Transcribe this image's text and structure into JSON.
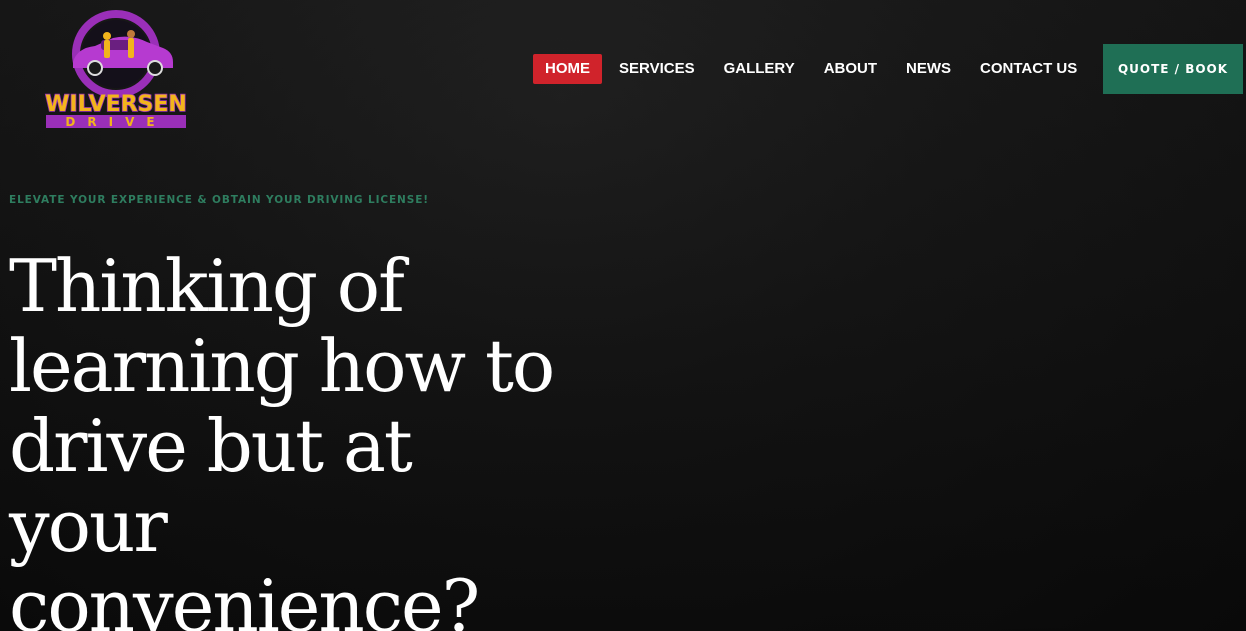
{
  "brand": {
    "logo_line1": "WILVERSEN",
    "logo_line2": "DRIVE",
    "colors": {
      "purple": "#9a2fb8",
      "gold": "#f2b51c"
    }
  },
  "nav": {
    "items": [
      {
        "label": "HOME",
        "active": true
      },
      {
        "label": "SERVICES",
        "active": false
      },
      {
        "label": "GALLERY",
        "active": false
      },
      {
        "label": "ABOUT",
        "active": false
      },
      {
        "label": "NEWS",
        "active": false
      },
      {
        "label": "CONTACT US",
        "active": false
      }
    ],
    "active_color": "#d0232b"
  },
  "cta": {
    "quote_label": "QUOTE / BOOK",
    "color": "#1f6f55"
  },
  "hero": {
    "eyebrow": "ELEVATE YOUR EXPERIENCE & OBTAIN YOUR DRIVING LICENSE!",
    "eyebrow_color": "#2e7d5f",
    "headline_lines": [
      "Thinking of",
      "learning how to",
      "drive but at your",
      "convenience?"
    ]
  }
}
